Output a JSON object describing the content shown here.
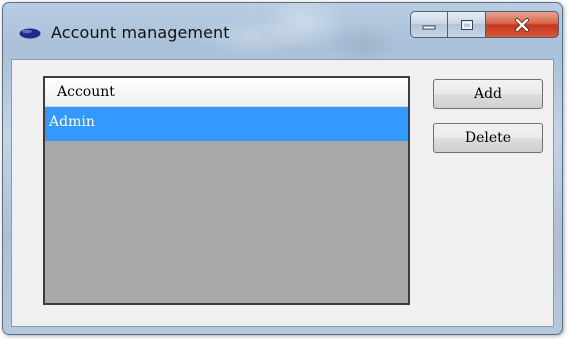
{
  "window": {
    "title": "Account management",
    "icon": "app-oval-icon",
    "caption_icons": {
      "minimize": "minimize-icon",
      "maximize": "maximize-icon",
      "close": "close-icon"
    }
  },
  "accounts_list": {
    "columns": [
      "Account"
    ],
    "rows": [
      {
        "account": "Admin",
        "selected": true
      }
    ]
  },
  "buttons": {
    "add_label": "Add",
    "delete_label": "Delete"
  },
  "colors": {
    "selection": "#3399ff",
    "list_background": "#a9a9a9",
    "close_button": "#c5361c"
  }
}
